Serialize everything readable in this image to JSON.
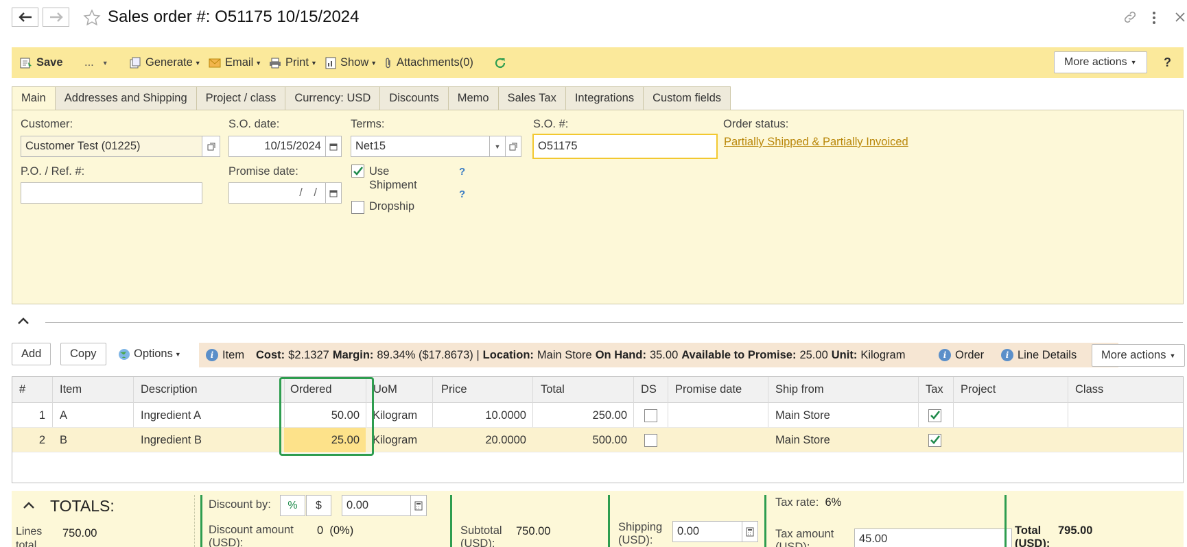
{
  "header": {
    "title": "Sales order #: O51175 10/15/2024"
  },
  "toolbar": {
    "save": "Save",
    "ellipsis": "...",
    "generate": "Generate",
    "email": "Email",
    "print": "Print",
    "show": "Show",
    "attachments": "Attachments(0)",
    "more_actions": "More actions",
    "help": "?"
  },
  "tabs": [
    {
      "label": "Main",
      "active": true
    },
    {
      "label": "Addresses and Shipping"
    },
    {
      "label": "Project / class"
    },
    {
      "label": "Currency: USD"
    },
    {
      "label": "Discounts"
    },
    {
      "label": "Memo"
    },
    {
      "label": "Sales Tax"
    },
    {
      "label": "Integrations"
    },
    {
      "label": "Custom fields"
    }
  ],
  "form": {
    "customer_label": "Customer:",
    "customer_value": "Customer Test (01225)",
    "so_date_label": "S.O. date:",
    "so_date_value": "10/15/2024",
    "terms_label": "Terms:",
    "terms_value": "Net15",
    "so_num_label": "S.O. #:",
    "so_num_value": "O51175",
    "order_status_label": "Order status:",
    "order_status_value": "Partially Shipped & Partially Invoiced",
    "po_label": "P.O. / Ref. #:",
    "po_value": "",
    "promise_label": "Promise date:",
    "promise_value": "/ /",
    "use_shipment_label_1": "Use",
    "use_shipment_label_2": "Shipment",
    "use_shipment_checked": true,
    "dropship_label": "Dropship",
    "dropship_checked": false,
    "help_mark": "?"
  },
  "grid_toolbar": {
    "add": "Add",
    "copy": "Copy",
    "options": "Options",
    "item_tab": "Item",
    "cost_label": "Cost:",
    "cost_value": "$2.1327",
    "margin_label": "Margin:",
    "margin_value": "89.34% ($17.8673) |",
    "location_label": "Location:",
    "location_value": "Main Store",
    "onhand_label": "On Hand:",
    "onhand_value": "35.00",
    "atp_label": "Available to Promise:",
    "atp_value": "25.00",
    "unit_label": "Unit:",
    "unit_value": "Kilogram",
    "order_tab": "Order",
    "line_details": "Line Details",
    "more_actions": "More actions"
  },
  "grid": {
    "columns": [
      "#",
      "Item",
      "Description",
      "Ordered",
      "UoM",
      "Price",
      "Total",
      "DS",
      "Promise date",
      "Ship from",
      "Tax",
      "Project",
      "Class"
    ],
    "rows": [
      {
        "num": "1",
        "item": "A",
        "description": "Ingredient A",
        "ordered": "50.00",
        "uom": "Kilogram",
        "price": "10.0000",
        "total": "250.00",
        "ds": false,
        "promise": "",
        "ship_from": "Main Store",
        "tax": true,
        "project": "",
        "class": ""
      },
      {
        "num": "2",
        "item": "B",
        "description": "Ingredient B",
        "ordered": "25.00",
        "uom": "Kilogram",
        "price": "20.0000",
        "total": "500.00",
        "ds": false,
        "promise": "",
        "ship_from": "Main Store",
        "tax": true,
        "project": "",
        "class": ""
      }
    ]
  },
  "totals": {
    "title": "TOTALS:",
    "lines_total_label_1": "Lines",
    "lines_total_label_2": "total",
    "lines_total_value": "750.00",
    "discount_by_label": "Discount by:",
    "pct": "%",
    "dollar": "$",
    "discount_value": "0.00",
    "discount_amount_label_1": "Discount amount",
    "discount_amount_label_2": "(USD):",
    "discount_amount_value": "0",
    "discount_amount_pct": "(0%)",
    "subtotal_label_1": "Subtotal",
    "subtotal_label_2": "(USD):",
    "subtotal_value": "750.00",
    "shipping_label_1": "Shipping",
    "shipping_label_2": "(USD):",
    "shipping_value": "0.00",
    "tax_rate_label": "Tax rate:",
    "tax_rate_value": "6%",
    "tax_amount_label_1": "Tax amount",
    "tax_amount_label_2": "(USD):",
    "tax_amount_value": "45.00",
    "total_label_1": "Total",
    "total_label_2": "(USD):",
    "total_value": "795.00"
  },
  "colors": {
    "toolbar_bg": "#fbe99b",
    "panel_bg": "#fdf8d8",
    "highlight_border": "#2e9d4f",
    "link": "#b9870a",
    "check": "#1e8a4a"
  }
}
